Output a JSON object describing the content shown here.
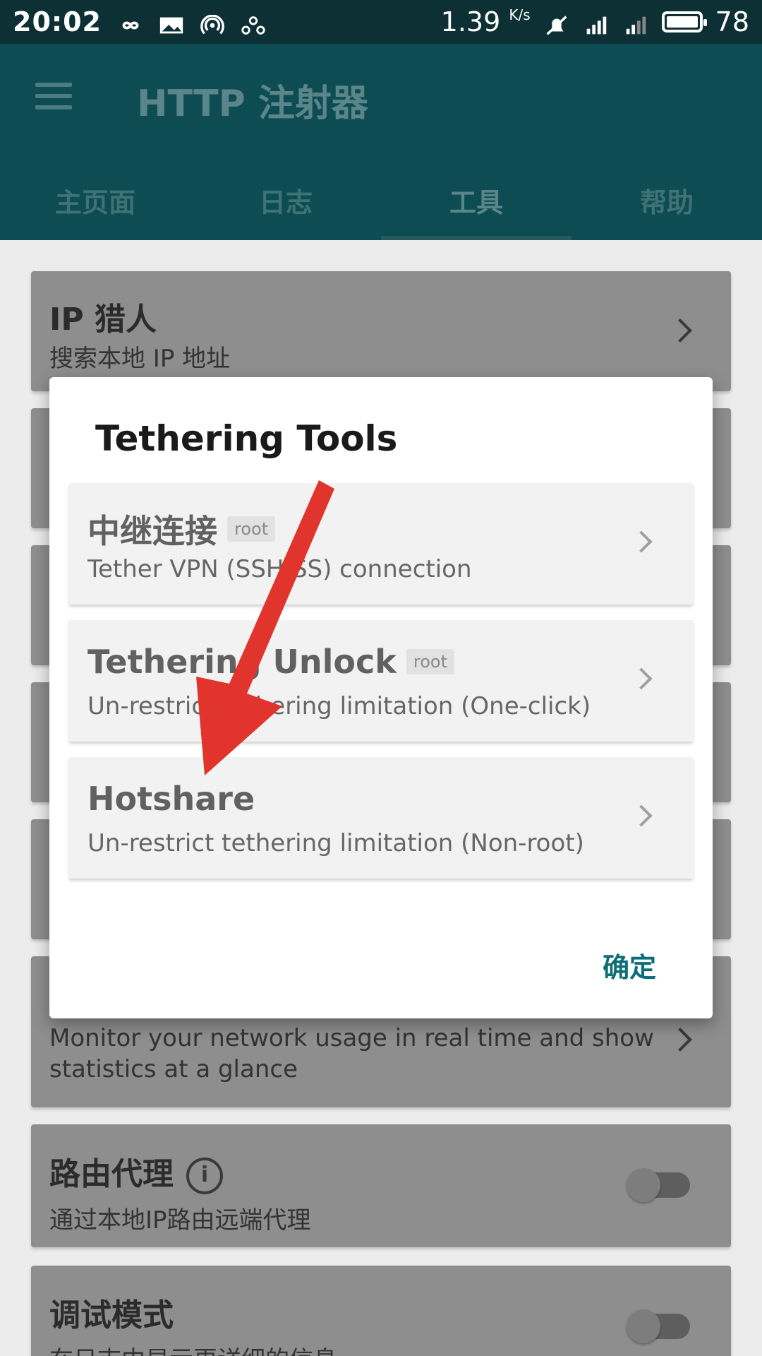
{
  "status_bar": {
    "time": "20:02",
    "speed": "1.39",
    "speed_unit": "K/s",
    "battery": "78",
    "icons_left": [
      "infinity-icon",
      "image-icon",
      "hotspot-icon",
      "link-icon"
    ],
    "icons_right": [
      "mute-icon",
      "signal-4g-icon",
      "signal-icon",
      "battery-icon"
    ]
  },
  "appbar": {
    "title": "HTTP 注射器",
    "tabs": [
      {
        "label": "主页面"
      },
      {
        "label": "日志"
      },
      {
        "label": "工具",
        "active": true
      },
      {
        "label": "帮助"
      }
    ]
  },
  "background": {
    "cards": [
      {
        "title": "IP 猎人",
        "subtitle": "搜索本地 IP 地址"
      },
      {
        "subtitle_line1": "Monitor your network usage in real time and show",
        "subtitle_line2": "statistics at a glance"
      },
      {
        "title": "路由代理",
        "subtitle": "通过本地IP路由远端代理",
        "toggle": false
      },
      {
        "title": "调试模式",
        "subtitle": "在日志中显示更详细的信息",
        "toggle": false
      }
    ]
  },
  "dialog": {
    "title": "Tethering Tools",
    "items": [
      {
        "name": "中继连接",
        "badge": "root",
        "desc": "Tether VPN (SSH/SS) connection"
      },
      {
        "name": "Tethering Unlock",
        "badge": "root",
        "desc": "Un-restrict tethering limitation (One-click)"
      },
      {
        "name": "Hotshare",
        "badge": "",
        "desc": "Un-restrict tethering limitation (Non-root)"
      }
    ],
    "ok_label": "确定"
  },
  "colors": {
    "appbar": "#0d4c52",
    "statusbar": "#0c3034",
    "accent": "#0e6e78",
    "annotation_arrow": "#e0342c"
  }
}
